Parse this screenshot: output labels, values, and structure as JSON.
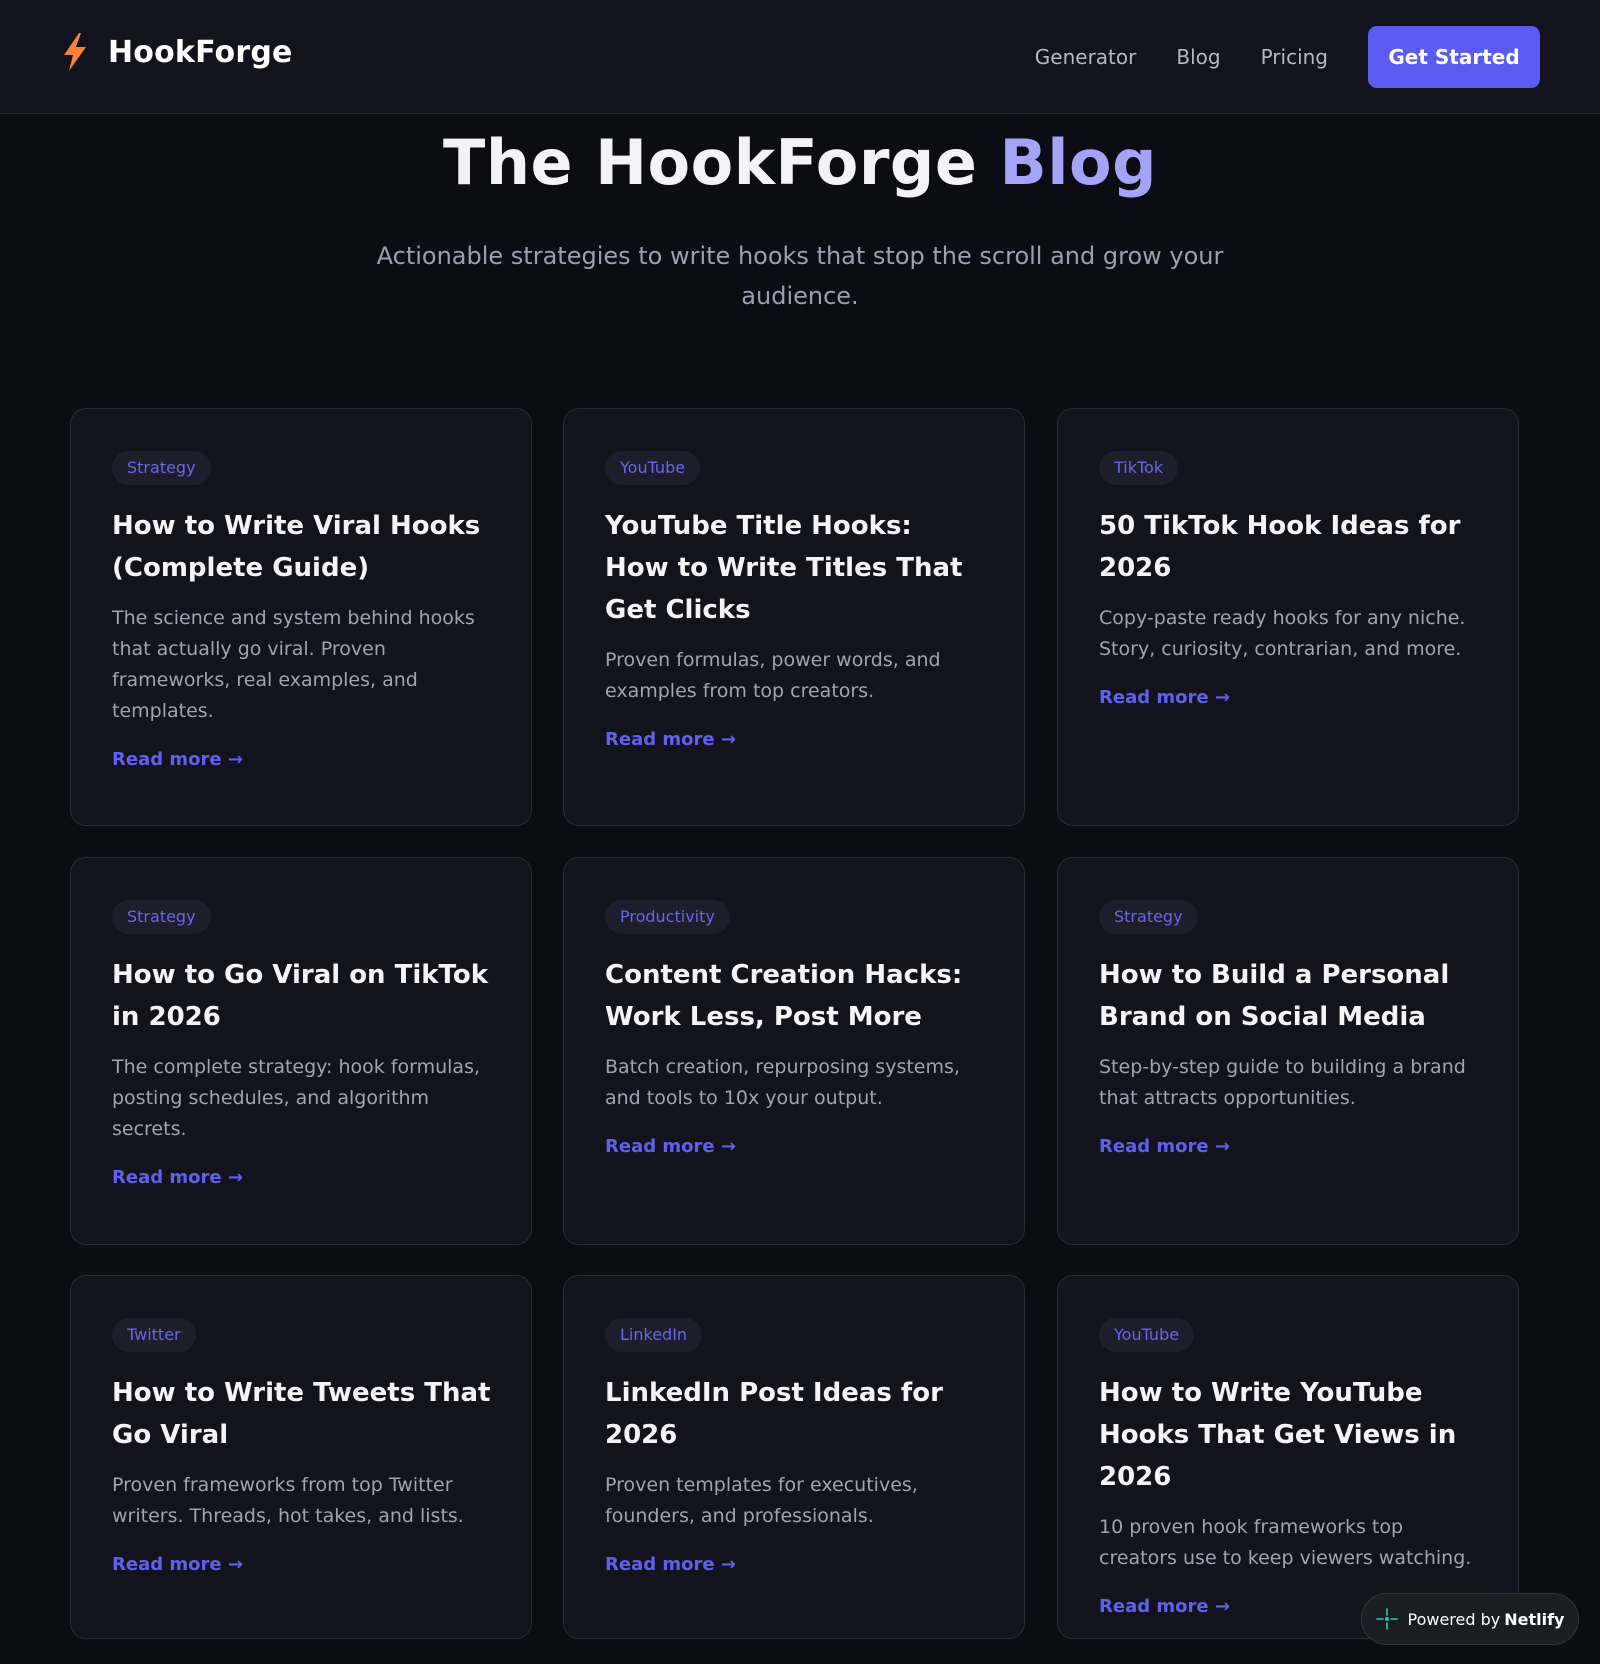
{
  "navbar": {
    "brand": "HookForge",
    "links": [
      {
        "label": "Generator"
      },
      {
        "label": "Blog"
      },
      {
        "label": "Pricing"
      }
    ],
    "cta_label": "Get Started"
  },
  "hero": {
    "title_part1": "The HookForge",
    "title_part2": "Blog",
    "subtitle": "Actionable strategies to write hooks that stop the scroll and grow your audience."
  },
  "posts": [
    {
      "category": "Strategy",
      "title": "How to Write Viral Hooks (Complete Guide)",
      "description": "The science and system behind hooks that actually go viral. Proven frameworks, real examples, and templates.",
      "link_label": "Read more →"
    },
    {
      "category": "YouTube",
      "title": "YouTube Title Hooks: How to Write Titles That Get Clicks",
      "description": "Proven formulas, power words, and examples from top creators.",
      "link_label": "Read more →"
    },
    {
      "category": "TikTok",
      "title": "50 TikTok Hook Ideas for 2026",
      "description": "Copy-paste ready hooks for any niche. Story, curiosity, contrarian, and more.",
      "link_label": "Read more →"
    },
    {
      "category": "Strategy",
      "title": "How to Go Viral on TikTok in 2026",
      "description": "The complete strategy: hook formulas, posting schedules, and algorithm secrets.",
      "link_label": "Read more →"
    },
    {
      "category": "Productivity",
      "title": "Content Creation Hacks: Work Less, Post More",
      "description": "Batch creation, repurposing systems, and tools to 10x your output.",
      "link_label": "Read more →"
    },
    {
      "category": "Strategy",
      "title": "How to Build a Personal Brand on Social Media",
      "description": "Step-by-step guide to building a brand that attracts opportunities.",
      "link_label": "Read more →"
    },
    {
      "category": "Twitter",
      "title": "How to Write Tweets That Go Viral",
      "description": "Proven frameworks from top Twitter writers. Threads, hot takes, and lists.",
      "link_label": "Read more →"
    },
    {
      "category": "LinkedIn",
      "title": "LinkedIn Post Ideas for 2026",
      "description": "Proven templates for executives, founders, and professionals.",
      "link_label": "Read more →"
    },
    {
      "category": "YouTube",
      "title": "How to Write YouTube Hooks That Get Views in 2026",
      "description": "10 proven hook frameworks top creators use to keep viewers watching.",
      "link_label": "Read more →"
    }
  ],
  "netlify_badge": {
    "prefix": "Powered by",
    "brand": "Netlify",
    "icon": "netlify-icon"
  },
  "colors": {
    "background": "#0c0c14",
    "card": "#13131d",
    "accent": "#5b5bf2",
    "title_accent": "#a3a3f7",
    "logo_bolt": "#f6823b"
  }
}
